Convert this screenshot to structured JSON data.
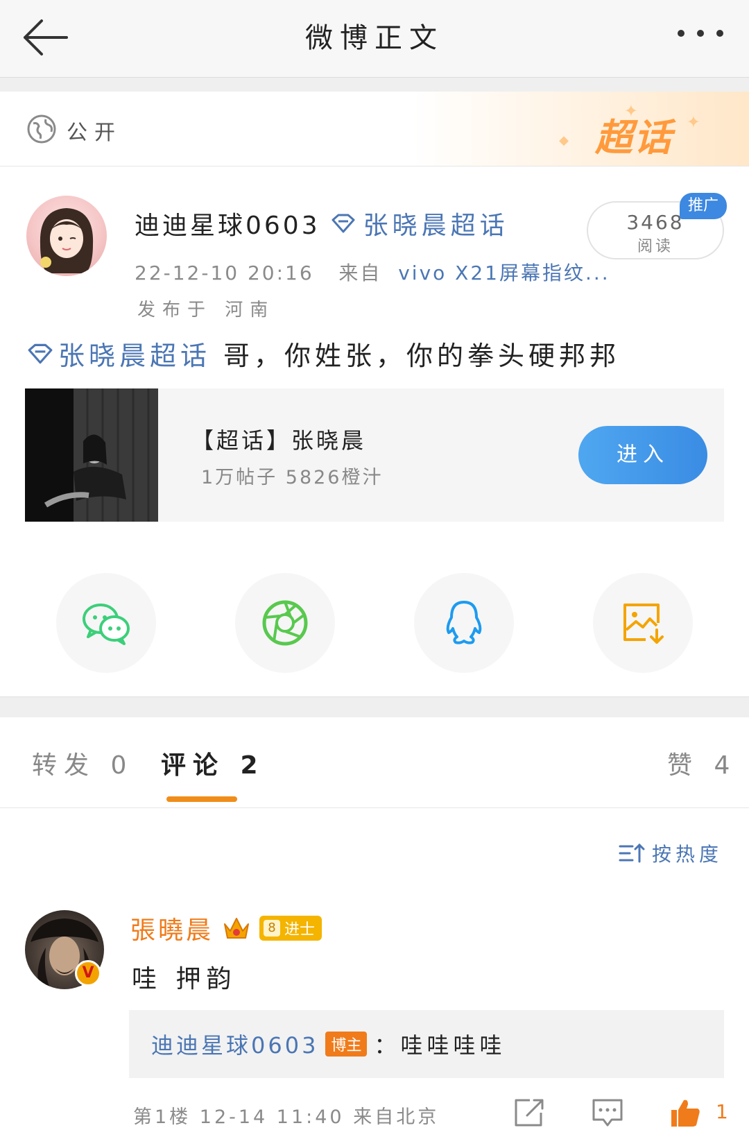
{
  "header": {
    "title": "微博正文"
  },
  "visibility": {
    "label": "公开",
    "chaohua_logo": "超话"
  },
  "post": {
    "username": "迪迪星球0603",
    "topic_name": "张晓晨超话",
    "timestamp": "22-12-10 20:16",
    "source_prefix": "来自",
    "source": "vivo X21屏幕指纹...",
    "location": "发布于 河南",
    "read_count": "3468",
    "read_label": "阅读",
    "promo_tag": "推广",
    "text_topic": "张晓晨超话",
    "text_body": "哥，你姓张，你的拳头硬邦邦"
  },
  "topic_card": {
    "title": "【超话】张晓晨",
    "stats": "1万帖子 5826橙汁",
    "enter_label": "进入"
  },
  "share": {
    "items": [
      "wechat-icon",
      "moments-icon",
      "qq-icon",
      "save-image-icon"
    ]
  },
  "tabs": {
    "repost": "转发 0",
    "comments": "评论 2",
    "likes": "赞 4"
  },
  "sort": {
    "label": "按热度"
  },
  "comment": {
    "name": "張曉晨",
    "level": "8",
    "level_title": "进士",
    "verified": "V",
    "text": "哇 押韵",
    "reply_user": "迪迪星球0603",
    "reply_badge": "博主",
    "reply_text": "：哇哇哇哇",
    "meta": "第1楼 12-14 11:40 来自北京",
    "like_count": "1"
  },
  "colors": {
    "link_blue": "#4b76b4",
    "accent_orange": "#f08d1a",
    "enter_blue": "#3a8ce4"
  }
}
